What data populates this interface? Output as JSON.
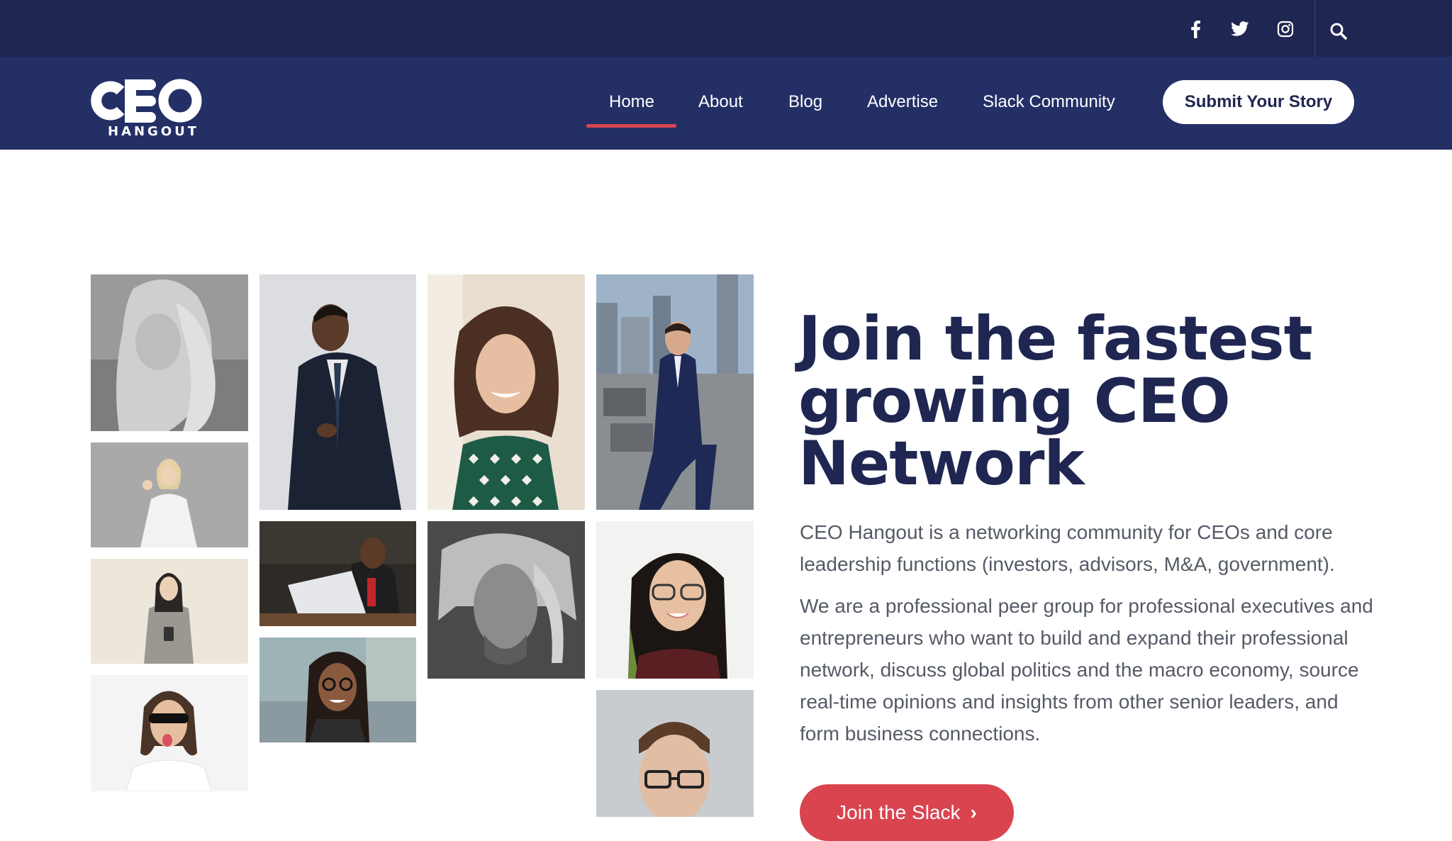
{
  "topbar": {
    "social": [
      {
        "name": "facebook-icon"
      },
      {
        "name": "twitter-icon"
      },
      {
        "name": "instagram-icon"
      }
    ],
    "search_icon": "search-icon"
  },
  "brand": {
    "logo_text": "CEO",
    "logo_sub": "HANGOUT"
  },
  "nav": {
    "items": [
      {
        "label": "Home",
        "active": true
      },
      {
        "label": "About"
      },
      {
        "label": "Blog"
      },
      {
        "label": "Advertise"
      },
      {
        "label": "Slack Community"
      }
    ],
    "cta": "Submit Your Story"
  },
  "hero": {
    "headline_lines": [
      "Join the fastest",
      "growing CEO",
      "Network"
    ],
    "para1": "CEO Hangout is a networking community for CEOs and core leadership functions (investors, advisors, M&A, government).",
    "para2": "We are a professional peer group for professional executives and entrepreneurs who want to build and expand their professional network, discuss global politics and the macro economy, source real-time opinions and insights from other senior leaders, and form business connections.",
    "button": "Join the Slack",
    "button_icon": "chevron-right-icon"
  },
  "colors": {
    "topbar": "#1f2651",
    "navbar": "#242f66",
    "accent": "#d9444f",
    "headline": "#1f2651",
    "body_text": "#555a66"
  }
}
